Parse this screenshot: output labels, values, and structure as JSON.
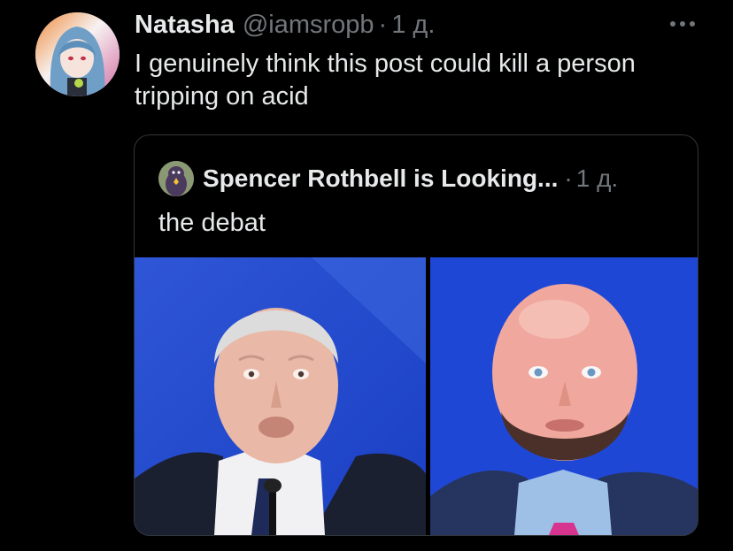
{
  "tweet": {
    "display_name": "Natasha",
    "handle": "@iamsropb",
    "separator": "·",
    "time": "1 д.",
    "text": "I genuinely think this post could kill a person tripping on acid",
    "more_icon": "more-horizontal-icon"
  },
  "quote": {
    "display_name": "Spencer Rothbell is Looking...",
    "separator": "·",
    "time": "1 д.",
    "text": "the debat"
  },
  "colors": {
    "background": "#000000",
    "primary_text": "#e7e9ea",
    "secondary_text": "#71767b",
    "border": "#333639",
    "photo_blue": "#1f47d6"
  }
}
